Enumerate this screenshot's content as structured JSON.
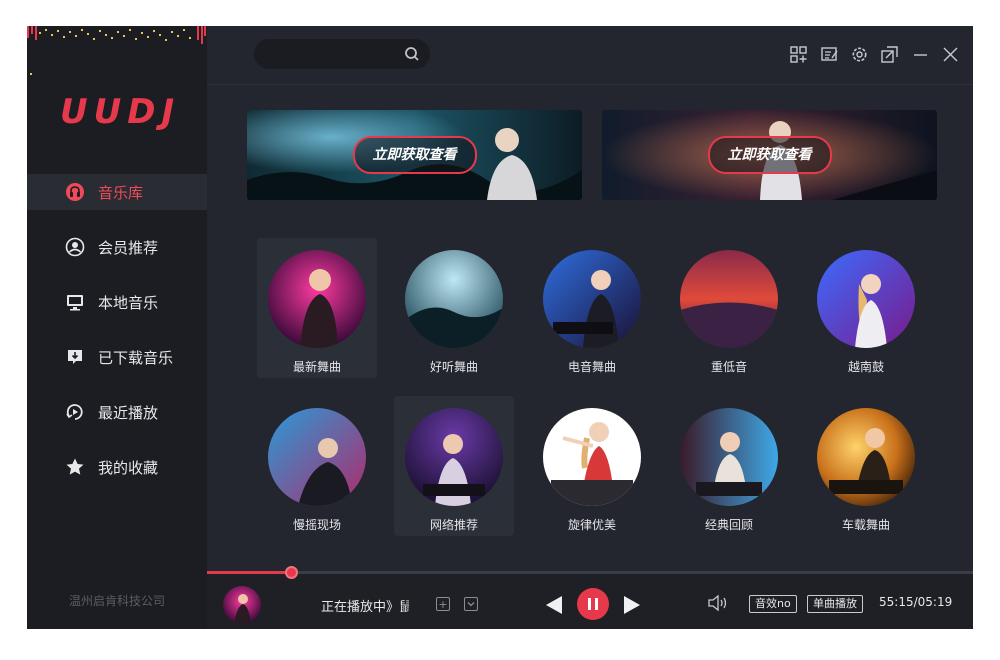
{
  "app": {
    "logo": "UUDJ",
    "company": "温州启肯科技公司"
  },
  "search": {
    "placeholder": "",
    "icon": "search-icon"
  },
  "window_controls": [
    "grid-add-icon",
    "notes-icon",
    "settings-icon",
    "mini-mode-icon",
    "minimize-icon",
    "close-icon"
  ],
  "sidebar": {
    "items": [
      {
        "label": "音乐库",
        "icon": "music-library-icon",
        "active": true
      },
      {
        "label": "会员推荐",
        "icon": "vip-recommend-icon",
        "active": false
      },
      {
        "label": "本地音乐",
        "icon": "local-music-icon",
        "active": false
      },
      {
        "label": "已下载音乐",
        "icon": "downloaded-icon",
        "active": false
      },
      {
        "label": "最近播放",
        "icon": "recent-play-icon",
        "active": false
      },
      {
        "label": "我的收藏",
        "icon": "favorite-star-icon",
        "active": false
      }
    ]
  },
  "banners": [
    {
      "button": "立即获取查看"
    },
    {
      "button": "立即获取查看"
    }
  ],
  "categories": [
    {
      "label": "最新舞曲",
      "selected": true
    },
    {
      "label": "好听舞曲",
      "selected": false
    },
    {
      "label": "电音舞曲",
      "selected": false
    },
    {
      "label": "重低音",
      "selected": false
    },
    {
      "label": "越南鼓",
      "selected": false
    },
    {
      "label": "慢摇现场",
      "selected": false
    },
    {
      "label": "网络推荐",
      "selected": true
    },
    {
      "label": "旋律优美",
      "selected": false
    },
    {
      "label": "经典回顾",
      "selected": false
    },
    {
      "label": "车载舞曲",
      "selected": false
    }
  ],
  "player": {
    "now_playing": "正在播放中》鼠",
    "progress": 0.11,
    "sound_effect": "音效no",
    "play_mode": "单曲播放",
    "time": "55:15/05:19",
    "state": "playing"
  },
  "colors": {
    "accent": "#e6394b",
    "background": "#23262e",
    "sidebar": "#1b1d23"
  }
}
